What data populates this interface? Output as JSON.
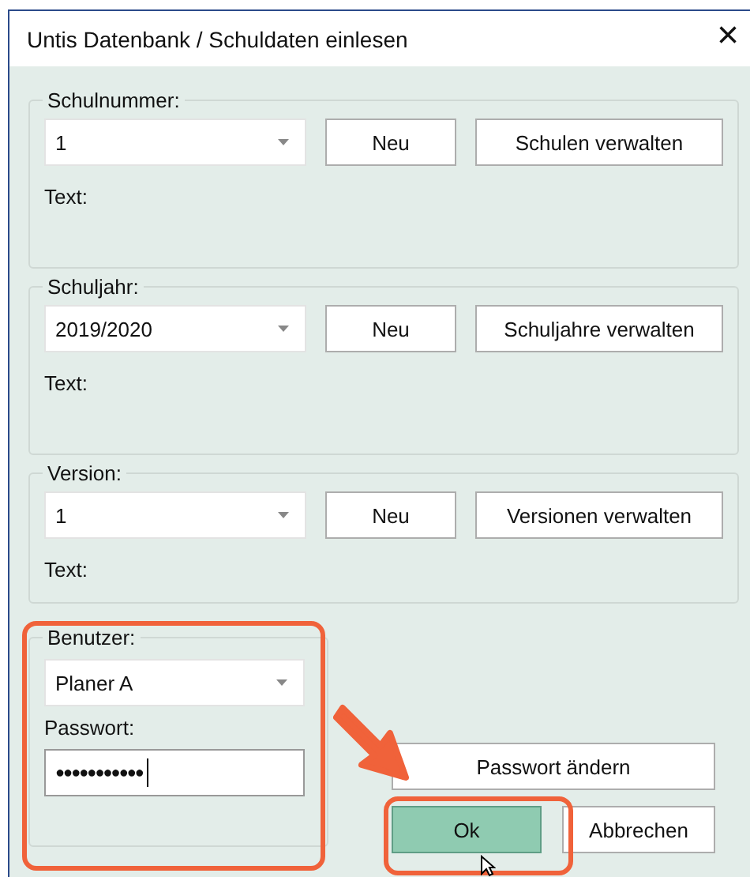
{
  "window": {
    "title": "Untis Datenbank / Schuldaten einlesen",
    "close": "×"
  },
  "groups": [
    {
      "legend": "Schulnummer:",
      "value": "1",
      "new_button": "Neu",
      "manage_button": "Schulen verwalten",
      "text_label": "Text:"
    },
    {
      "legend": "Schuljahr:",
      "value": "2019/2020",
      "new_button": "Neu",
      "manage_button": "Schuljahre verwalten",
      "text_label": "Text:"
    },
    {
      "legend": "Version:",
      "value": "1",
      "new_button": "Neu",
      "manage_button": "Versionen verwalten",
      "text_label": "Text:"
    }
  ],
  "user_group": {
    "legend": "Benutzer:",
    "user": "Planer A",
    "password_label": "Passwort:",
    "password": "●●●●●●●●●●●"
  },
  "buttons": {
    "change_password": "Passwort ändern",
    "ok": "Ok",
    "cancel": "Abbrechen"
  }
}
